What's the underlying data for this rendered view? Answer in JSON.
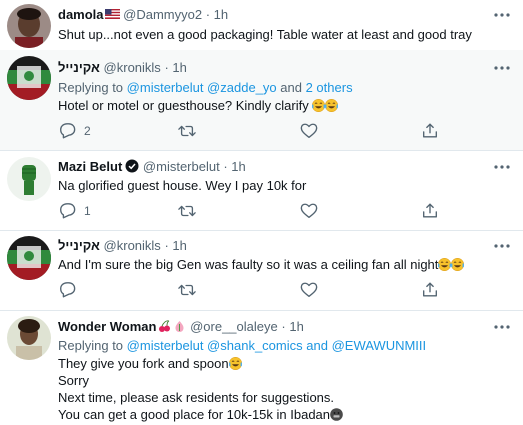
{
  "tweets": [
    {
      "name": "damola",
      "handle": "@Dammyyo2",
      "time": "1h",
      "text": "Shut up...not even a good packaging! Table water at least and good tray"
    },
    {
      "name": "אקינייל",
      "handle": "@kronikls",
      "time": "1h",
      "replying_label": "Replying to",
      "replying_users": "@misterbelut @zadde_yo",
      "replying_and": "and",
      "replying_others": "2 others",
      "text": "Hotel or motel or guesthouse? Kindly clarify",
      "reply_count": "2"
    },
    {
      "name": "Mazi Belut",
      "handle": "@misterbelut",
      "time": "1h",
      "text": "Na glorified guest house. Wey I pay 10k for",
      "reply_count": "1"
    },
    {
      "name": "אקינייל",
      "handle": "@kronikls",
      "time": "1h",
      "text": "And I'm sure the big Gen was faulty so it was a ceiling fan all night"
    },
    {
      "name": "Wonder Woman",
      "handle": "@ore__olaleye",
      "time": "1h",
      "replying_label": "Replying to",
      "replying_users": "@misterbelut @shank_comics",
      "replying_and": "and",
      "replying_others": "@EWAWUNMIII",
      "lines": [
        "They give you fork and spoon",
        "Sorry",
        "Next time, please ask residents for suggestions.",
        "You can get a good place for 10k-15k in Ibadan"
      ]
    }
  ],
  "separator_dot": "·",
  "colors": {
    "link": "#1b95e0",
    "muted": "#536471",
    "highlight_bg": "#f7f9f9",
    "divider": "#e1e8ed"
  },
  "icons": [
    "reply-icon",
    "retweet-icon",
    "like-icon",
    "share-icon",
    "more-icon",
    "verified-icon",
    "us-flag-icon",
    "tears-of-joy-emoji",
    "grimace-emoji",
    "cherries-emoji",
    "fist-emoji"
  ]
}
